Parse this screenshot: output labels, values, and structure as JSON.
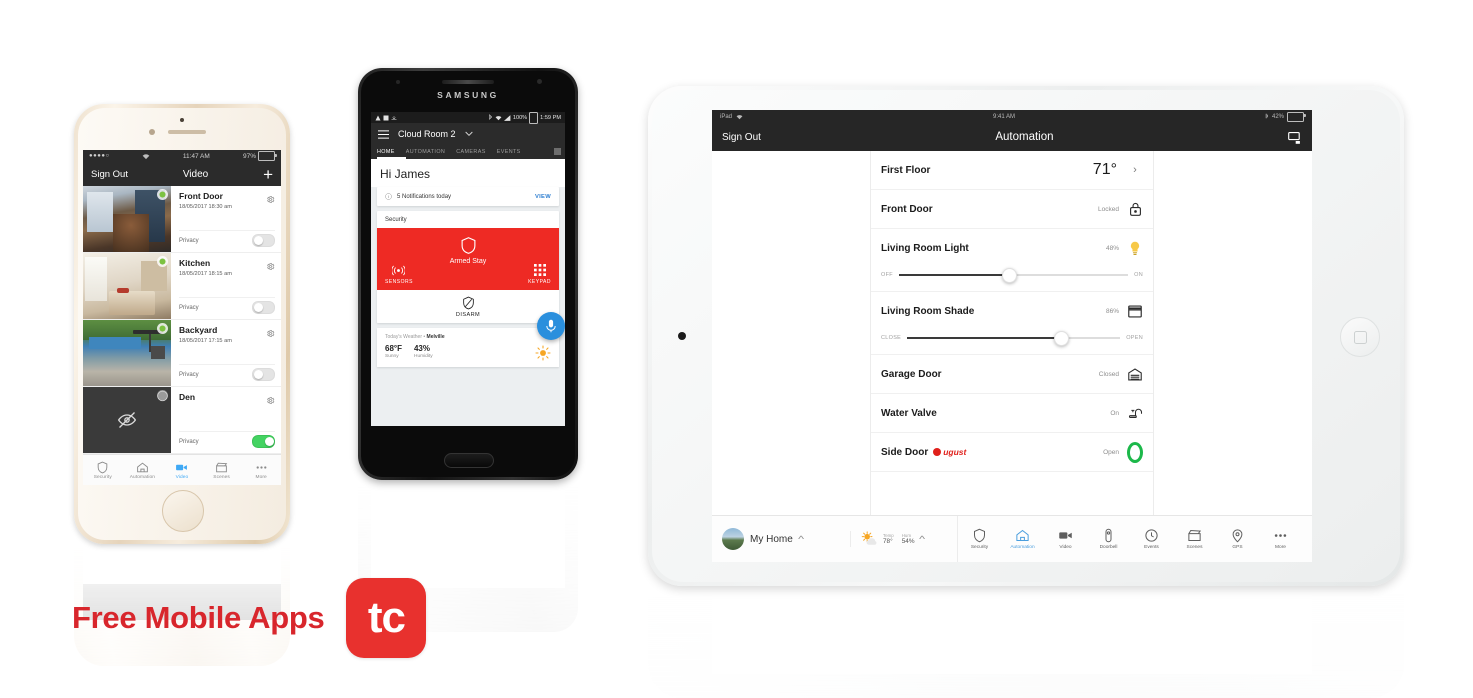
{
  "caption": {
    "text": "Free Mobile Apps",
    "logo_text": "tc",
    "brand_red": "#e8312e"
  },
  "iphone": {
    "status_bar": {
      "signal": "●●●●○",
      "wifi": "wifi-icon",
      "time": "11:47 AM",
      "battery": "97%"
    },
    "nav": {
      "left": "Sign Out",
      "title": "Video",
      "right": "+"
    },
    "cameras": [
      {
        "name": "Front Door",
        "timestamp": "18/05/2017 18:30 am",
        "privacy_label": "Privacy",
        "privacy_on": false,
        "thumb": "hallway-dog"
      },
      {
        "name": "Kitchen",
        "timestamp": "18/05/2017 18:15 am",
        "privacy_label": "Privacy",
        "privacy_on": false,
        "thumb": "kitchen"
      },
      {
        "name": "Backyard",
        "timestamp": "18/05/2017 17:15 am",
        "privacy_label": "Privacy",
        "privacy_on": false,
        "thumb": "backyard-pool"
      },
      {
        "name": "Den",
        "timestamp": "",
        "privacy_label": "Privacy",
        "privacy_on": true,
        "thumb": "privacy-blocked"
      }
    ],
    "tabs": [
      {
        "label": "Security",
        "icon": "shield-icon",
        "active": false
      },
      {
        "label": "Automation",
        "icon": "house-icon",
        "active": false
      },
      {
        "label": "Video",
        "icon": "camcorder-icon",
        "active": true
      },
      {
        "label": "Scenes",
        "icon": "clapper-icon",
        "active": false
      },
      {
        "label": "More",
        "icon": "ellipsis-icon",
        "active": false
      }
    ]
  },
  "samsung": {
    "brand": "SAMSUNG",
    "status_bar": {
      "battery": "100%",
      "time": "1:59 PM"
    },
    "appbar": {
      "menu": "hamburger-icon",
      "title": "Cloud Room 2",
      "chevron": "chevron-down-icon"
    },
    "tabs": [
      {
        "label": "HOME",
        "active": true
      },
      {
        "label": "AUTOMATION",
        "active": false
      },
      {
        "label": "CAMERAS",
        "active": false
      },
      {
        "label": "EVENTS",
        "active": false
      }
    ],
    "greeting": "Hi James",
    "notifications": {
      "text": "5 Notifications today",
      "action": "VIEW"
    },
    "security": {
      "section_label": "Security",
      "state": "Armed Stay",
      "sensors_label": "SENSORS",
      "keypad_label": "KEYPAD",
      "disarm_label": "DISARM",
      "panel_color": "#ee2a24"
    },
    "weather": {
      "header_prefix": "Today's Weather • ",
      "location": "Melville",
      "temp_value": "68°F",
      "temp_label": "Sunny",
      "humidity_value": "43%",
      "humidity_label": "Humidity"
    },
    "fab": "microphone-icon"
  },
  "ipad": {
    "status_bar": {
      "device": "iPad",
      "wifi": "wifi-icon",
      "time": "9:41 AM",
      "battery": "42%"
    },
    "nav": {
      "left": "Sign Out",
      "title": "Automation",
      "right_icon": "cast-icon"
    },
    "rows": [
      {
        "name": "First Floor",
        "value": "71°",
        "value_style": "big",
        "control": "chevron-right-icon",
        "slider": null
      },
      {
        "name": "Front Door",
        "value": "Locked",
        "value_style": "small",
        "control": "lock-icon",
        "slider": null
      },
      {
        "name": "Living Room Light",
        "value": "48%",
        "value_style": "small",
        "control": "bulb-icon",
        "slider": {
          "left_label": "OFF",
          "right_label": "ON",
          "percent": 48
        }
      },
      {
        "name": "Living Room Shade",
        "value": "86%",
        "value_style": "small",
        "control": "shade-icon",
        "slider": {
          "left_label": "CLOSE",
          "right_label": "OPEN",
          "percent": 72
        }
      },
      {
        "name": "Garage Door",
        "value": "Closed",
        "value_style": "small",
        "control": "garage-icon",
        "slider": null
      },
      {
        "name": "Water Valve",
        "value": "On",
        "value_style": "small",
        "control": "faucet-icon",
        "slider": null
      },
      {
        "name": "Side Door",
        "badge": "august",
        "badge_text": "ugust",
        "value": "Open",
        "value_style": "small",
        "control": "ring-open-icon",
        "slider": null
      }
    ],
    "home_chip": {
      "label": "My Home",
      "avatar": "home-photo-avatar",
      "caret": "chevron-up-icon"
    },
    "weather": {
      "icon": "sun-cloud-icon",
      "temp_label": "Temp",
      "temp_value": "78°",
      "hum_label": "Hum",
      "hum_value": "54%",
      "caret": "chevron-up-icon"
    },
    "tabs": [
      {
        "label": "Security",
        "icon": "shield-icon",
        "active": false
      },
      {
        "label": "Automation",
        "icon": "house-icon",
        "active": true
      },
      {
        "label": "Video",
        "icon": "camcorder-icon",
        "active": false
      },
      {
        "label": "Doorbell",
        "icon": "doorbell-icon",
        "active": false
      },
      {
        "label": "Events",
        "icon": "clock-icon",
        "active": false
      },
      {
        "label": "Scenes",
        "icon": "clapper-icon",
        "active": false
      },
      {
        "label": "GPS",
        "icon": "location-pin-icon",
        "active": false
      },
      {
        "label": "More",
        "icon": "ellipsis-icon",
        "active": false
      }
    ]
  }
}
